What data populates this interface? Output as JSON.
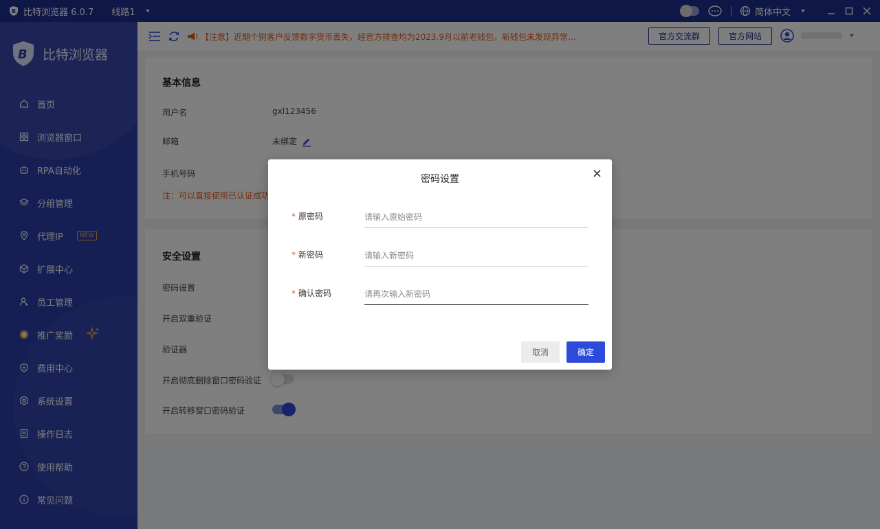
{
  "app": {
    "title": "比特浏览器 6.0.7",
    "route": "线路1",
    "language": "简体中文"
  },
  "sidebar": {
    "brand": "比特浏览器",
    "items": [
      {
        "label": "首页",
        "icon": "home-icon"
      },
      {
        "label": "浏览器窗口",
        "icon": "grid-icon"
      },
      {
        "label": "RPA自动化",
        "icon": "robot-icon"
      },
      {
        "label": "分组管理",
        "icon": "layers-icon"
      },
      {
        "label": "代理IP",
        "icon": "location-icon",
        "badge": "NEW"
      },
      {
        "label": "扩展中心",
        "icon": "cube-icon"
      },
      {
        "label": "员工管理",
        "icon": "users-icon"
      },
      {
        "label": "推广奖励",
        "icon": "reward-icon"
      },
      {
        "label": "费用中心",
        "icon": "shield-icon"
      },
      {
        "label": "系统设置",
        "icon": "gear-icon"
      },
      {
        "label": "操作日志",
        "icon": "log-icon"
      },
      {
        "label": "使用帮助",
        "icon": "help-icon"
      },
      {
        "label": "常见问题",
        "icon": "info-icon"
      }
    ]
  },
  "toolbar": {
    "notice": "【注意】近期个别客户反馈数字货币丢失，经官方排查均为2023.9月以前老钱包，新钱包未发现异常...",
    "group_button": "官方交流群",
    "site_button": "官方网站"
  },
  "basic": {
    "title": "基本信息",
    "username_label": "用户名",
    "username_value": "gxl123456",
    "email_label": "邮箱",
    "email_value": "未绑定",
    "phone_label": "手机号码",
    "note": "注：可以直接使用已认证成功"
  },
  "security": {
    "title": "安全设置",
    "password_label": "密码设置",
    "twofa_label": "开启双重验证",
    "authenticator_label": "验证器",
    "delete_verify_label": "开启彻底删除窗口密码验证",
    "delete_verify_on": false,
    "transfer_verify_label": "开启转移窗口密码验证",
    "transfer_verify_on": true
  },
  "dialog": {
    "title": "密码设置",
    "required_mark": "*",
    "old_label": "原密码",
    "old_placeholder": "请输入原始密码",
    "new_label": "新密码",
    "new_placeholder": "请输入新密码",
    "confirm_label": "确认密码",
    "confirm_placeholder": "请再次输入新密码",
    "cancel": "取消",
    "ok": "确定"
  },
  "colors": {
    "titlebar": "#1e2f8f",
    "sidebar": "#2a3ea6",
    "primary": "#2d4bd8",
    "warning": "#e05a1c"
  }
}
